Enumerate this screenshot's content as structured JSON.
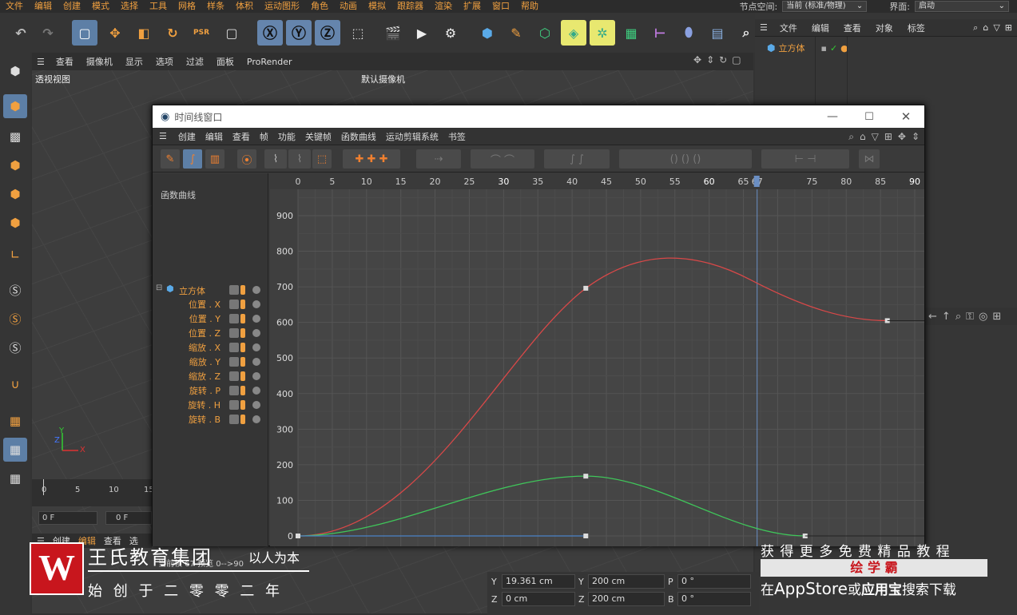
{
  "menubar": {
    "items": [
      "文件",
      "编辑",
      "创建",
      "模式",
      "选择",
      "工具",
      "网格",
      "样条",
      "体积",
      "运动图形",
      "角色",
      "动画",
      "模拟",
      "跟踪器",
      "渲染",
      "扩展",
      "窗口",
      "帮助"
    ],
    "node_space_label": "节点空间:",
    "node_space_value": "当前 (标准/物理)",
    "interface_label": "界面:",
    "interface_value": "启动"
  },
  "right_panel": {
    "menu": [
      "文件",
      "编辑",
      "查看",
      "对象",
      "标签"
    ],
    "object_name": "立方体"
  },
  "viewport": {
    "menu": [
      "查看",
      "摄像机",
      "显示",
      "选项",
      "过滤",
      "面板",
      "ProRender"
    ],
    "view_name": "透视视图",
    "camera_label": "默认摄像机",
    "axis_x": "X",
    "axis_y": "Y",
    "axis_z": "Z"
  },
  "mini_timeline": {
    "ticks": [
      "0",
      "5",
      "10",
      "15"
    ],
    "field1": "0 F",
    "field2": "0 F",
    "footer": "当前帧 67 预览 0-->90",
    "tabs": [
      "创建",
      "编辑",
      "查看",
      "选"
    ]
  },
  "timeline_window": {
    "title": "时间线窗口",
    "menu": [
      "创建",
      "编辑",
      "查看",
      "帧",
      "功能",
      "关键帧",
      "函数曲线",
      "运动剪辑系统",
      "书签"
    ],
    "panel_title": "函数曲线",
    "root_track": "立方体",
    "tracks": [
      "位置 . X",
      "位置 . Y",
      "位置 . Z",
      "缩放 . X",
      "缩放 . Y",
      "缩放 . Z",
      "旋转 . P",
      "旋转 . H",
      "旋转 . B"
    ]
  },
  "chart_data": {
    "type": "line",
    "x_ticks": [
      "0",
      "5",
      "10",
      "15",
      "20",
      "25",
      "30",
      "35",
      "40",
      "45",
      "50",
      "55",
      "60",
      "65",
      "67",
      "75",
      "80",
      "85",
      "90"
    ],
    "y_ticks": [
      "0",
      "100",
      "200",
      "300",
      "400",
      "500",
      "600",
      "700",
      "800",
      "900"
    ],
    "xlim": [
      0,
      90
    ],
    "ylim": [
      0,
      900
    ],
    "current_frame": 67,
    "series": [
      {
        "color": "#d84848",
        "points": [
          [
            0,
            0
          ],
          [
            42,
            696
          ],
          [
            53,
            780
          ],
          [
            86,
            605
          ]
        ]
      },
      {
        "color": "#3fc65a",
        "points": [
          [
            0,
            0
          ],
          [
            42,
            168
          ],
          [
            74,
            0
          ]
        ]
      },
      {
        "color": "#4a82c8",
        "points": [
          [
            0,
            0
          ],
          [
            42,
            0
          ]
        ]
      }
    ]
  },
  "coords": {
    "y_label": "Y",
    "y_value": "19.361 cm",
    "z_label": "Z",
    "z_value": "0 cm",
    "sy_label": "Y",
    "sy_value": "200 cm",
    "sz_label": "Z",
    "sz_value": "200 cm",
    "p_label": "P",
    "p_value": "0 °",
    "b_label": "B",
    "b_value": "0 °"
  },
  "watermark": {
    "logo_text": "W",
    "company": "王氏教育集团",
    "slogan": "以人为本",
    "founded": "始 创 于 二 零 零 二 年"
  },
  "promo": {
    "line1": "获 得 更 多 免 费 精 品 教 程",
    "brand": "绘 学 霸",
    "line3_a": "在",
    "line3_b": "AppStore",
    "line3_c": "或",
    "line3_d": "应用宝",
    "line3_e": "搜索下载"
  }
}
